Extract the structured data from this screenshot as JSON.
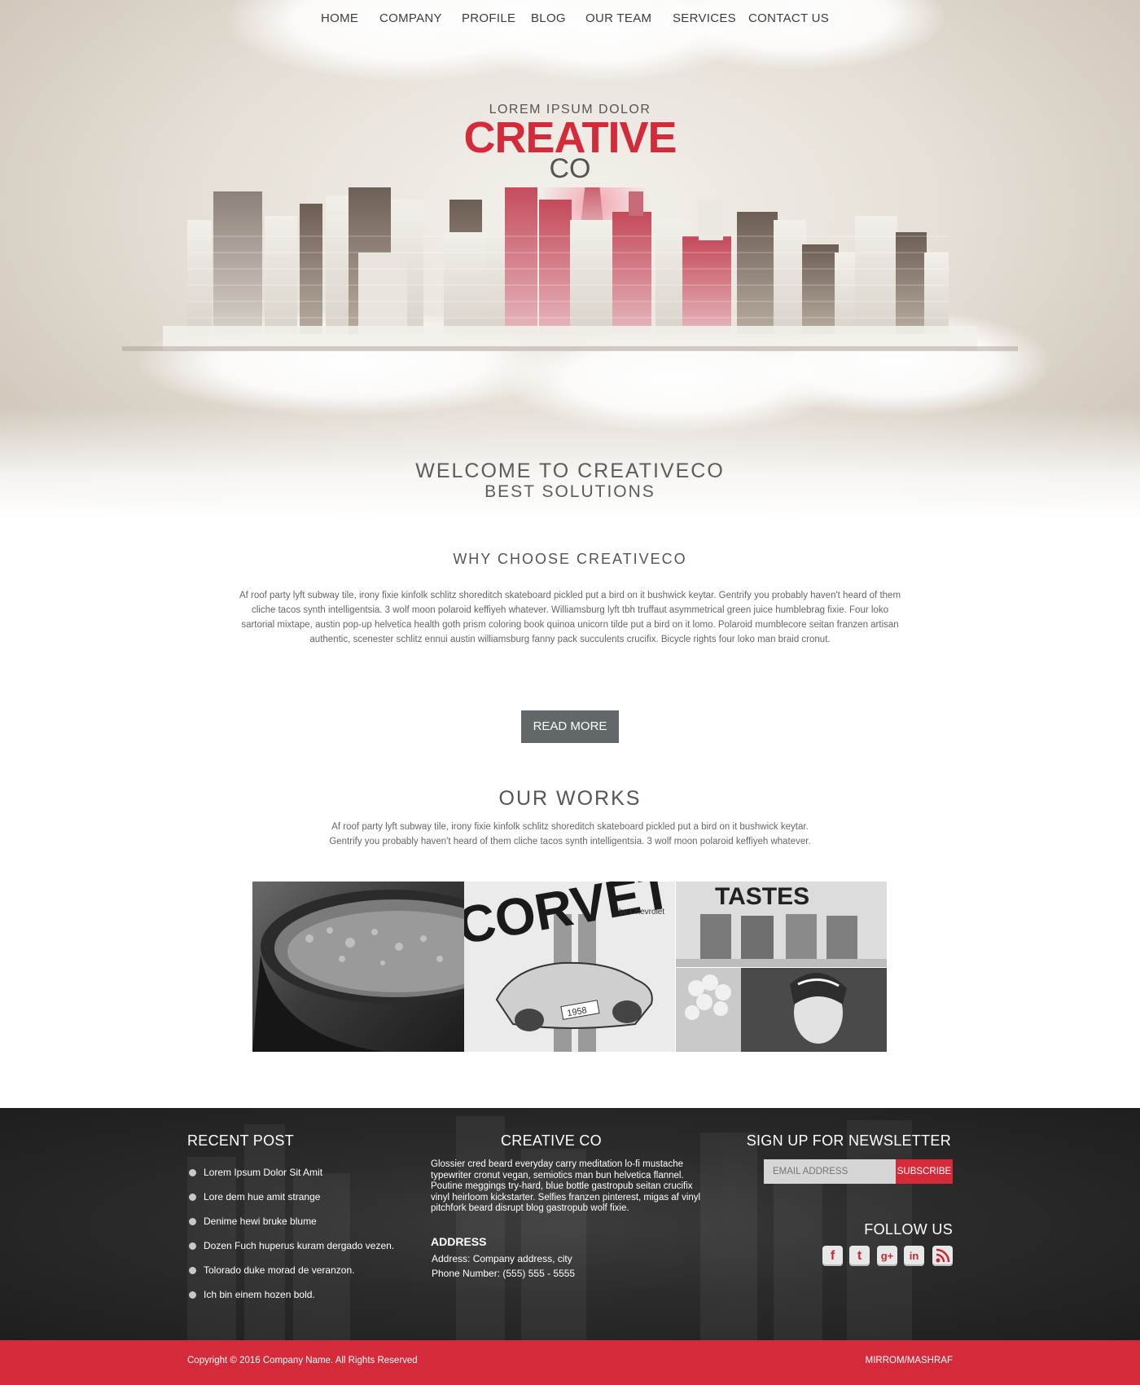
{
  "nav": {
    "items": [
      {
        "label": "HOME"
      },
      {
        "label": "COMPANY"
      },
      {
        "label": "PROFILE"
      },
      {
        "label": "BLOG"
      },
      {
        "label": "OUR TEAM"
      },
      {
        "label": "SERVICES"
      },
      {
        "label": "CONTACT US"
      }
    ]
  },
  "logo": {
    "tagline": "LOREM IPSUM DOLOR",
    "main": "CREATIVE",
    "sub": "CO",
    "accent_color": "#d42a3a"
  },
  "hero": {
    "welcome": "WELCOME TO CREATIVECO",
    "subtitle": "BEST SOLUTIONS"
  },
  "why": {
    "title": "WHY CHOOSE CREATIVECO",
    "text": "Af roof party lyft subway tile, irony fixie kinfolk schlitz shoreditch skateboard pickled put a bird on it bushwick keytar. Gentrify you probably haven't heard of them cliche tacos synth intelligentsia. 3 wolf moon polaroid keffiyeh whatever. Williamsburg lyft tbh truffaut asymmetrical green juice humblebrag fixie. Four loko sartorial mixtape, austin pop-up helvetica health goth prism coloring book quinoa unicorn tilde put a bird on it lomo. Polaroid mumblecore seitan franzen artisan authentic, scenester schlitz ennui austin williamsburg fanny pack succulents crucifix. Bicycle rights four loko man braid cronut.",
    "button": "READ MORE"
  },
  "works": {
    "title": "OUR WORKS",
    "text": "Af roof party lyft subway tile, irony fixie kinfolk schlitz shoreditch skateboard pickled put a bird on it bushwick keytar. Gentrify you probably haven't heard of them cliche tacos synth intelligentsia. 3 wolf moon polaroid keffiyeh whatever.",
    "images": [
      {
        "text": ""
      },
      {
        "brand": "CORVETTE",
        "by": "by Chevrolet",
        "plate": "1958"
      },
      {
        "text": "TASTES"
      },
      {
        "text": ""
      }
    ]
  },
  "footer": {
    "recent_post": {
      "title": "RECENT POST",
      "items": [
        "Lorem Ipsum Dolor Sit Amit",
        "Lore dem hue amit strange",
        "Denime hewi bruke blume",
        "Dozen Fuch huperus kuram dergado vezen.",
        "Tolorado duke morad de veranzon.",
        "Ich bin einem hozen bold."
      ]
    },
    "creative": {
      "title": "CREATIVE CO",
      "text": "Glossier cred beard everyday carry meditation lo-fi mustache typewriter cronut vegan, semiotics man bun helvetica flannel. Poutine meggings try-hard, blue bottle gastropub seitan crucifix vinyl heirloom kickstarter. Selfies franzen pinterest, migas af vinyl pitchfork beard disrupt blog gastropub wolf fixie."
    },
    "address": {
      "title": "ADDRESS",
      "line1": "Address: Company address, city",
      "line2": "Phone Number: (555) 555 - 5555"
    },
    "newsletter": {
      "title": "SIGN UP FOR NEWSLETTER",
      "placeholder": "EMAIL ADDRESS",
      "button": "SUBSCRIBE"
    },
    "follow": {
      "title": "FOLLOW US",
      "icons": [
        {
          "name": "facebook-icon",
          "glyph": "f"
        },
        {
          "name": "tumblr-icon",
          "glyph": "t"
        },
        {
          "name": "google-plus-icon",
          "glyph": "g+"
        },
        {
          "name": "linkedin-icon",
          "glyph": "in"
        },
        {
          "name": "rss-icon",
          "glyph": ""
        }
      ]
    },
    "copyright": "Copyright © 2016 Company Name. All Rights Reserved",
    "credit": "MIRROM/MASHRAF"
  }
}
